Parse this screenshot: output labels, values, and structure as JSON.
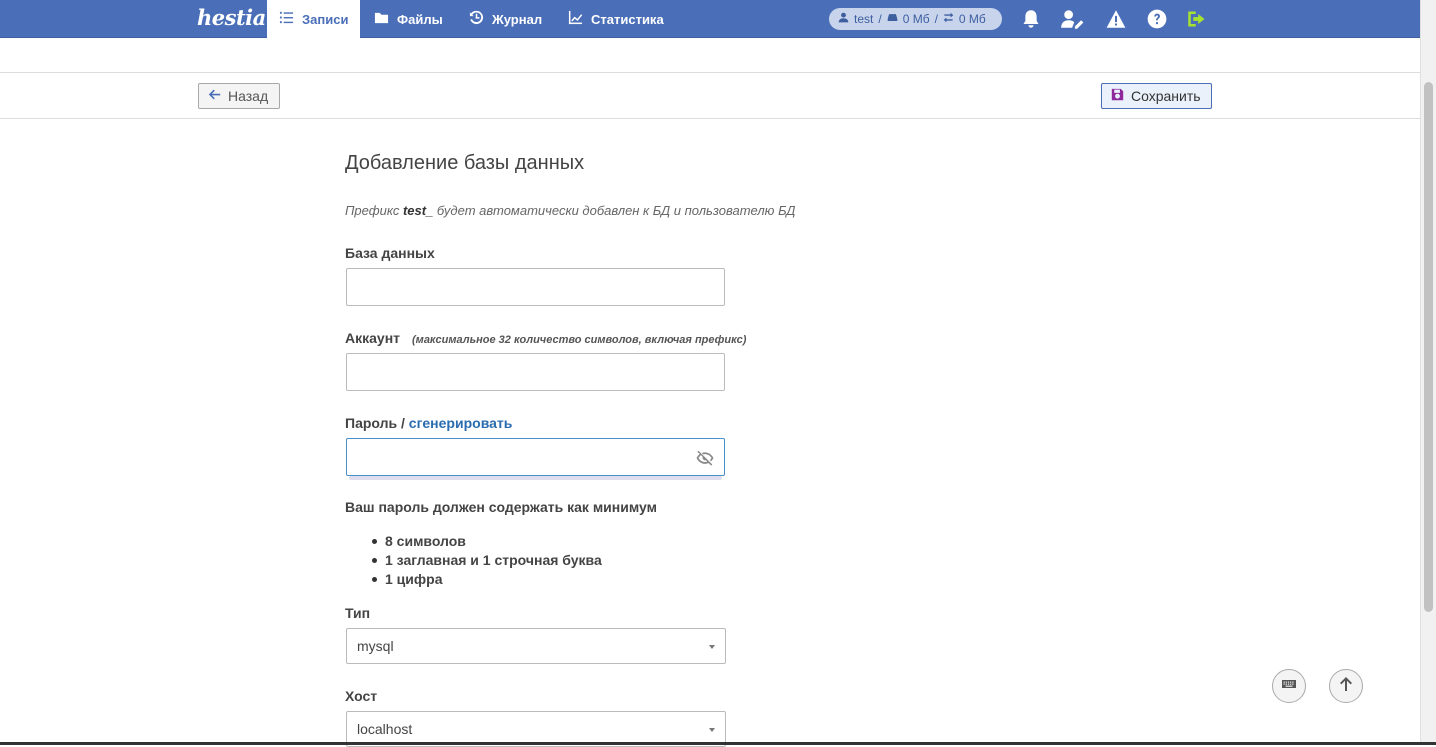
{
  "nav": {
    "logo": "hestia",
    "items": [
      {
        "label": "Записи",
        "icon": "list-icon",
        "active": true
      },
      {
        "label": "Файлы",
        "icon": "folder-icon",
        "active": false
      },
      {
        "label": "Журнал",
        "icon": "history-icon",
        "active": false
      },
      {
        "label": "Статистика",
        "icon": "chart-line-icon",
        "active": false
      }
    ],
    "user": {
      "name": "test",
      "disk": "0 Мб",
      "bandwidth": "0 Мб",
      "sep1": "/",
      "sep2": "/"
    }
  },
  "toolbar": {
    "back_label": "Назад",
    "save_label": "Сохранить"
  },
  "form": {
    "title": "Добавление базы данных",
    "hint_before": "Префикс ",
    "hint_prefix": "test_",
    "hint_after": " будет автоматически добавлен к БД и пользователю БД",
    "database_label": "База данных",
    "database_value": "",
    "account_label": "Аккаунт",
    "account_note": "(максимальное 32 количество символов, включая префикс)",
    "account_value": "",
    "password_label": "Пароль / ",
    "password_generate": "сгенерировать",
    "password_value": "",
    "requirements_title": "Ваш пароль должен содержать как минимум",
    "requirements": [
      "8 символов",
      "1 заглавная и 1 строчная буква",
      "1 цифра"
    ],
    "type_label": "Тип",
    "type_value": "mysql",
    "host_label": "Хост",
    "host_value": "localhost"
  },
  "colors": {
    "nav_bg": "#4a6fb8",
    "accent": "#2a6cb0",
    "save_icon": "#8e2a9c",
    "logout_icon": "#a6e22e"
  }
}
